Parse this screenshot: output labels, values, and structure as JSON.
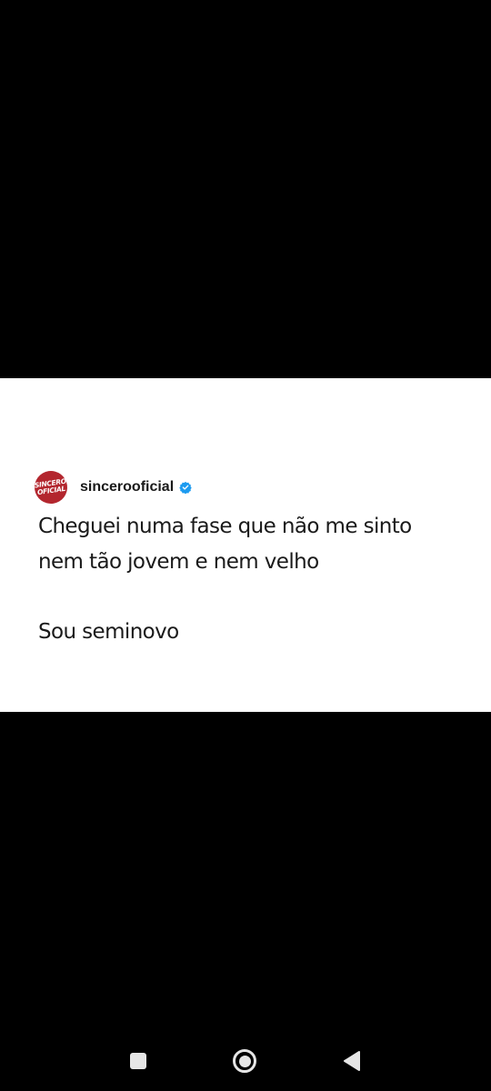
{
  "post": {
    "avatar": {
      "line1": "SINCERO",
      "line2": "OFICIAL",
      "color": "#b3262e"
    },
    "username": "sincerooficial",
    "verified_icon": "verified-badge-icon",
    "verified_color": "#1d9bf0",
    "text_lines": [
      "Cheguei numa fase que não me sinto",
      "nem tão jovem e nem velho"
    ],
    "punchline": "Sou seminovo"
  },
  "nav_bar": {
    "recent_icon": "square-icon",
    "home_icon": "circle-home-icon",
    "back_icon": "triangle-back-icon"
  }
}
